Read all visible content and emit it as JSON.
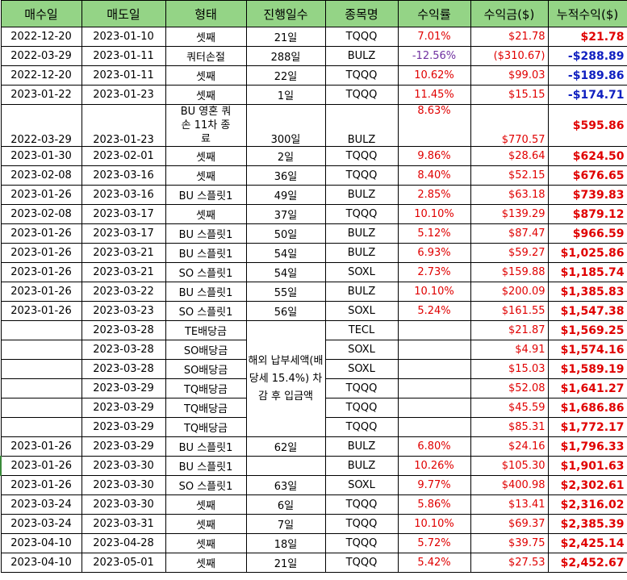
{
  "headers": [
    "매수일",
    "매도일",
    "형태",
    "진행일수",
    "종목명",
    "수익률",
    "수익금($)",
    "누적수익($)"
  ],
  "rows": [
    {
      "buy": "2022-12-20",
      "sell": "2023-01-10",
      "type": "셋째",
      "days": "21일",
      "ticker": "TQQQ",
      "rate": "7.01%",
      "profit": "$21.78",
      "cum": "$21.78",
      "rate_color": "red",
      "cum_color": "red"
    },
    {
      "buy": "2022-03-29",
      "sell": "2023-01-11",
      "type": "쿼터손절",
      "days": "288일",
      "ticker": "BULZ",
      "rate": "-12.56%",
      "profit": "($310.67)",
      "cum": "-$288.89",
      "rate_color": "purple",
      "cum_color": "blue"
    },
    {
      "buy": "2022-12-20",
      "sell": "2023-01-11",
      "type": "셋째",
      "days": "22일",
      "ticker": "TQQQ",
      "rate": "10.62%",
      "profit": "$99.03",
      "cum": "-$189.86",
      "rate_color": "red",
      "cum_color": "blue"
    },
    {
      "buy": "2023-01-22",
      "sell": "2023-01-23",
      "type": "셋째",
      "days": "1일",
      "ticker": "TQQQ",
      "rate": "11.45%",
      "profit": "$15.15",
      "cum": "-$174.71",
      "rate_color": "red",
      "cum_color": "blue"
    },
    {
      "buy": "2022-03-29",
      "sell": "2023-01-23",
      "type": "BU 영혼 쿼손 11차 종료",
      "days": "300일",
      "ticker": "BULZ",
      "rate": "8.63%",
      "profit": "$770.57",
      "cum": "$595.86",
      "rate_color": "red",
      "cum_color": "red",
      "tall": true
    },
    {
      "buy": "2023-01-30",
      "sell": "2023-02-01",
      "type": "셋째",
      "days": "2일",
      "ticker": "TQQQ",
      "rate": "9.86%",
      "profit": "$28.64",
      "cum": "$624.50",
      "rate_color": "red",
      "cum_color": "red"
    },
    {
      "buy": "2023-02-08",
      "sell": "2023-03-16",
      "type": "셋째",
      "days": "36일",
      "ticker": "TQQQ",
      "rate": "8.40%",
      "profit": "$52.15",
      "cum": "$676.65",
      "rate_color": "red",
      "cum_color": "red"
    },
    {
      "buy": "2023-01-26",
      "sell": "2023-03-16",
      "type": "BU 스플릿1",
      "days": "49일",
      "ticker": "BULZ",
      "rate": "2.85%",
      "profit": "$63.18",
      "cum": "$739.83",
      "rate_color": "red",
      "cum_color": "red"
    },
    {
      "buy": "2023-02-08",
      "sell": "2023-03-17",
      "type": "셋째",
      "days": "37일",
      "ticker": "TQQQ",
      "rate": "10.10%",
      "profit": "$139.29",
      "cum": "$879.12",
      "rate_color": "red",
      "cum_color": "red"
    },
    {
      "buy": "2023-01-26",
      "sell": "2023-03-17",
      "type": "BU 스플릿1",
      "days": "50일",
      "ticker": "BULZ",
      "rate": "5.12%",
      "profit": "$87.47",
      "cum": "$966.59",
      "rate_color": "red",
      "cum_color": "red"
    },
    {
      "buy": "2023-01-26",
      "sell": "2023-03-21",
      "type": "BU 스플릿1",
      "days": "54일",
      "ticker": "BULZ",
      "rate": "6.93%",
      "profit": "$59.27",
      "cum": "$1,025.86",
      "rate_color": "red",
      "cum_color": "red"
    },
    {
      "buy": "2023-01-26",
      "sell": "2023-03-21",
      "type": "SO 스플릿1",
      "days": "54일",
      "ticker": "SOXL",
      "rate": "2.73%",
      "profit": "$159.88",
      "cum": "$1,185.74",
      "rate_color": "red",
      "cum_color": "red"
    },
    {
      "buy": "2023-01-26",
      "sell": "2023-03-22",
      "type": "BU 스플릿1",
      "days": "55일",
      "ticker": "BULZ",
      "rate": "10.10%",
      "profit": "$200.09",
      "cum": "$1,385.83",
      "rate_color": "red",
      "cum_color": "red"
    },
    {
      "buy": "2023-01-26",
      "sell": "2023-03-23",
      "type": "SO 스플릿1",
      "days": "56일",
      "ticker": "SOXL",
      "rate": "5.24%",
      "profit": "$161.55",
      "cum": "$1,547.38",
      "rate_color": "red",
      "cum_color": "red"
    }
  ],
  "dividend_note": "해외 납부세액(배당세 15.4%) 차감 후 입금액",
  "dividends": [
    {
      "sell": "2023-03-28",
      "type": "TE배당금",
      "ticker": "TECL",
      "profit": "$21.87",
      "cum": "$1,569.25"
    },
    {
      "sell": "2023-03-28",
      "type": "SO배당금",
      "ticker": "SOXL",
      "profit": "$4.91",
      "cum": "$1,574.16"
    },
    {
      "sell": "2023-03-28",
      "type": "SO배당금",
      "ticker": "SOXL",
      "profit": "$15.03",
      "cum": "$1,589.19"
    },
    {
      "sell": "2023-03-29",
      "type": "TQ배당금",
      "ticker": "TQQQ",
      "profit": "$52.08",
      "cum": "$1,641.27"
    },
    {
      "sell": "2023-03-29",
      "type": "TQ배당금",
      "ticker": "TQQQ",
      "profit": "$45.59",
      "cum": "$1,686.86"
    },
    {
      "sell": "2023-03-29",
      "type": "TQ배당금",
      "ticker": "TQQQ",
      "profit": "$85.31",
      "cum": "$1,772.17"
    }
  ],
  "rows2": [
    {
      "buy": "2023-01-26",
      "sell": "2023-03-29",
      "type": "BU 스플릿1",
      "days": "62일",
      "ticker": "BULZ",
      "rate": "6.80%",
      "profit": "$24.16",
      "cum": "$1,796.33"
    },
    {
      "buy": "2023-01-26",
      "sell": "2023-03-30",
      "type": "BU 스플릿1",
      "days": "",
      "ticker": "BULZ",
      "rate": "10.26%",
      "profit": "$105.30",
      "cum": "$1,901.63",
      "greenleft": true
    },
    {
      "buy": "2023-01-26",
      "sell": "2023-03-30",
      "type": "SO 스플릿1",
      "days": "63일",
      "ticker": "SOXL",
      "rate": "9.77%",
      "profit": "$400.98",
      "cum": "$2,302.61"
    },
    {
      "buy": "2023-03-24",
      "sell": "2023-03-30",
      "type": "셋째",
      "days": "6일",
      "ticker": "TQQQ",
      "rate": "5.86%",
      "profit": "$13.41",
      "cum": "$2,316.02"
    },
    {
      "buy": "2023-03-24",
      "sell": "2023-03-31",
      "type": "셋째",
      "days": "7일",
      "ticker": "TQQQ",
      "rate": "10.10%",
      "profit": "$69.37",
      "cum": "$2,385.39"
    },
    {
      "buy": "2023-04-10",
      "sell": "2023-04-28",
      "type": "셋째",
      "days": "18일",
      "ticker": "TQQQ",
      "rate": "5.72%",
      "profit": "$39.75",
      "cum": "$2,425.14"
    },
    {
      "buy": "2023-04-10",
      "sell": "2023-05-01",
      "type": "셋째",
      "days": "21일",
      "ticker": "TQQQ",
      "rate": "5.42%",
      "profit": "$27.53",
      "cum": "$2,452.67"
    }
  ]
}
